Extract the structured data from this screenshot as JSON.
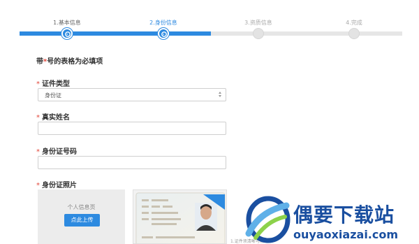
{
  "steps": [
    {
      "label": "1.基本信息",
      "state": "done"
    },
    {
      "label": "2.身份信息",
      "state": "current"
    },
    {
      "label": "3.资质信息",
      "state": "todo"
    },
    {
      "label": "4.完成",
      "state": "todo"
    }
  ],
  "colors": {
    "accent": "#2d8ae0",
    "required": "#e2463a",
    "watermark": "#1a4fa0"
  },
  "form": {
    "required_note_prefix": "带",
    "required_note_star": "*",
    "required_note_suffix": "号的表格为必填项",
    "id_type": {
      "label": "证件类型",
      "selected": "身份证"
    },
    "real_name": {
      "label": "真实姓名",
      "value": ""
    },
    "id_number": {
      "label": "身份证号码",
      "value": ""
    },
    "id_photo": {
      "label": "身份证照片",
      "upload_hint": "个人信息页",
      "upload_button": "点此上传",
      "caption": "1.证件须清晰可辨"
    }
  },
  "watermark": {
    "title": "偶要下载站",
    "url": "ouyaoxiazai.com"
  }
}
